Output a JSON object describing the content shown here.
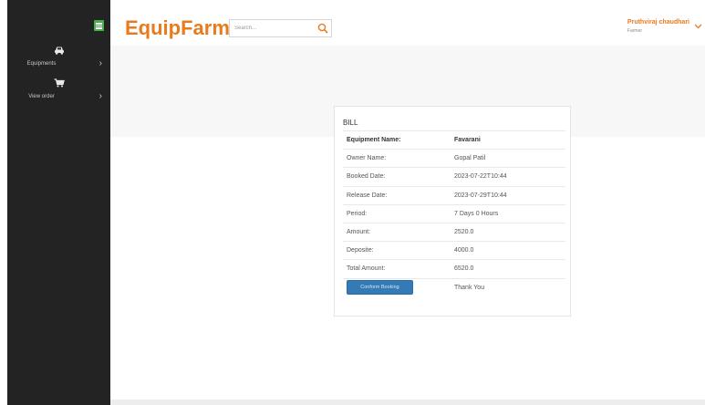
{
  "app": {
    "brand": "EquipFarm"
  },
  "search": {
    "placeholder": "Search..."
  },
  "user": {
    "name": "Pruthviraj chaudhari",
    "role": "Farmer"
  },
  "sidebar": {
    "items": [
      {
        "label": "Equipments",
        "icon": "car-icon"
      },
      {
        "label": "View order",
        "icon": "cart-icon"
      }
    ]
  },
  "bill": {
    "title": "BILL",
    "rows": [
      {
        "label": "Equipment Name:",
        "value": "Favarani"
      },
      {
        "label": "Owner Name:",
        "value": "Gopal Patil"
      },
      {
        "label": "Booked Date:",
        "value": "2023-07-22T10:44"
      },
      {
        "label": "Release Date:",
        "value": "2023-07-29T10:44"
      },
      {
        "label": "Period:",
        "value": "7 Days 0 Hours"
      },
      {
        "label": "Amount:",
        "value": "2520.0"
      },
      {
        "label": "Deposite:",
        "value": "4000.0"
      },
      {
        "label": "Total Amount:",
        "value": "6520.0"
      }
    ],
    "confirm_label": "Conform Booking",
    "thank_you": "Thank You"
  },
  "colors": {
    "brand": "#e87b1e",
    "sidebar": "#232323",
    "button": "#337ab7",
    "toggle": "#4cae4c"
  }
}
